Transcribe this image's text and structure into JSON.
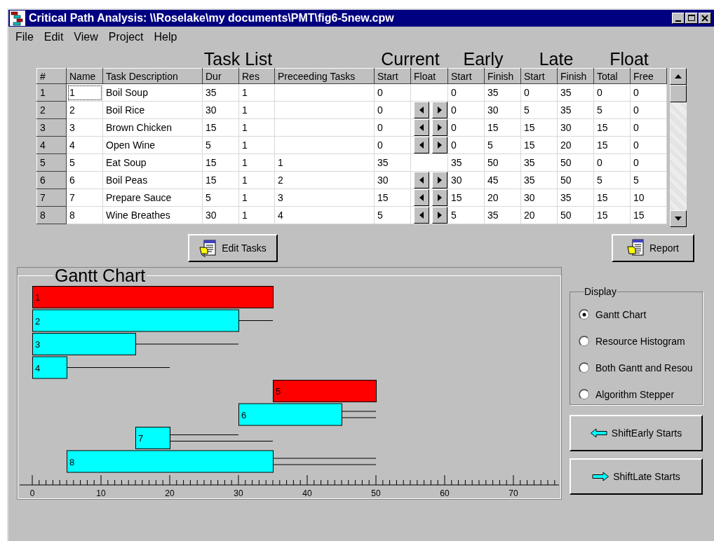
{
  "window": {
    "title": "Critical Path Analysis: \\\\Roselake\\my documents\\PMT\\fig6-5new.cpw"
  },
  "menu": [
    "File",
    "Edit",
    "View",
    "Project",
    "Help"
  ],
  "table": {
    "group_headings": [
      "Task List",
      "Current",
      "Early",
      "Late",
      "Float"
    ],
    "columns": [
      "#",
      "Name",
      "Task Description",
      "Dur",
      "Res",
      "Preceeding Tasks",
      "Start",
      "Float",
      "Start",
      "Finish",
      "Start",
      "Finish",
      "Total",
      "Free"
    ],
    "rows": [
      {
        "row_number": "1",
        "name": "1",
        "description": "Boil Soup",
        "dur": "35",
        "res": "1",
        "preceding": "",
        "current_start": "0",
        "shift_arrows": false,
        "early_start": "0",
        "early_finish": "35",
        "late_start": "0",
        "late_finish": "35",
        "total_float": "0",
        "free_float": "0",
        "focused": true
      },
      {
        "row_number": "2",
        "name": "2",
        "description": "Boil Rice",
        "dur": "30",
        "res": "1",
        "preceding": "",
        "current_start": "0",
        "shift_arrows": true,
        "early_start": "0",
        "early_finish": "30",
        "late_start": "5",
        "late_finish": "35",
        "total_float": "5",
        "free_float": "0",
        "focused": false
      },
      {
        "row_number": "3",
        "name": "3",
        "description": "Brown Chicken",
        "dur": "15",
        "res": "1",
        "preceding": "",
        "current_start": "0",
        "shift_arrows": true,
        "early_start": "0",
        "early_finish": "15",
        "late_start": "15",
        "late_finish": "30",
        "total_float": "15",
        "free_float": "0",
        "focused": false
      },
      {
        "row_number": "4",
        "name": "4",
        "description": "Open Wine",
        "dur": "5",
        "res": "1",
        "preceding": "",
        "current_start": "0",
        "shift_arrows": true,
        "early_start": "0",
        "early_finish": "5",
        "late_start": "15",
        "late_finish": "20",
        "total_float": "15",
        "free_float": "0",
        "focused": false
      },
      {
        "row_number": "5",
        "name": "5",
        "description": "Eat Soup",
        "dur": "15",
        "res": "1",
        "preceding": "1",
        "current_start": "35",
        "shift_arrows": false,
        "early_start": "35",
        "early_finish": "50",
        "late_start": "35",
        "late_finish": "50",
        "total_float": "0",
        "free_float": "0",
        "focused": false
      },
      {
        "row_number": "6",
        "name": "6",
        "description": "Boil Peas",
        "dur": "15",
        "res": "1",
        "preceding": "2",
        "current_start": "30",
        "shift_arrows": true,
        "early_start": "30",
        "early_finish": "45",
        "late_start": "35",
        "late_finish": "50",
        "total_float": "5",
        "free_float": "5",
        "focused": false
      },
      {
        "row_number": "7",
        "name": "7",
        "description": "Prepare Sauce",
        "dur": "5",
        "res": "1",
        "preceding": "3",
        "current_start": "15",
        "shift_arrows": true,
        "early_start": "15",
        "early_finish": "20",
        "late_start": "30",
        "late_finish": "35",
        "total_float": "15",
        "free_float": "10",
        "focused": false
      },
      {
        "row_number": "8",
        "name": "8",
        "description": "Wine Breathes",
        "dur": "30",
        "res": "1",
        "preceding": "4",
        "current_start": "5",
        "shift_arrows": true,
        "early_start": "5",
        "early_finish": "35",
        "late_start": "20",
        "late_finish": "50",
        "total_float": "15",
        "free_float": "15",
        "focused": false
      }
    ]
  },
  "buttons": {
    "edit_tasks": "Edit Tasks",
    "report": "Report"
  },
  "gantt": {
    "title": "Gantt Chart",
    "bars": [
      {
        "label": "1",
        "critical": true
      },
      {
        "label": "2",
        "critical": false
      },
      {
        "label": "3",
        "critical": false
      },
      {
        "label": "4",
        "critical": false
      },
      {
        "label": "5",
        "critical": true
      },
      {
        "label": "6",
        "critical": false
      },
      {
        "label": "7",
        "critical": false
      },
      {
        "label": "8",
        "critical": false
      }
    ],
    "axis_labels": [
      "0",
      "10",
      "20",
      "30",
      "40",
      "50",
      "60",
      "70"
    ]
  },
  "display": {
    "title": "Display",
    "options": [
      {
        "label": "Gantt Chart",
        "selected": true
      },
      {
        "label": "Resource Histogram",
        "selected": false
      },
      {
        "label": "Both Gantt and Resou",
        "selected": false
      },
      {
        "label": "Algorithm Stepper",
        "selected": false
      }
    ]
  },
  "shift_buttons": [
    {
      "label": "ShiftEarly Starts",
      "kind": "left"
    },
    {
      "label": "ShiftLate Starts",
      "kind": "right"
    }
  ]
}
